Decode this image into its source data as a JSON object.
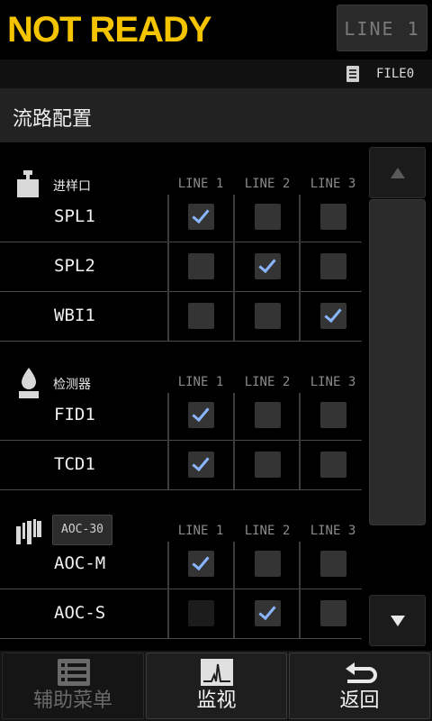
{
  "status": {
    "text": "NOT READY",
    "line": "LINE 1"
  },
  "file": {
    "label": "FILE0"
  },
  "screen_title": "流路配置",
  "columns": [
    "LINE 1",
    "LINE 2",
    "LINE 3"
  ],
  "groups": [
    {
      "label": "进样口",
      "icon": "injector-icon",
      "rows": [
        {
          "label": "SPL1",
          "checks": [
            true,
            false,
            false
          ]
        },
        {
          "label": "SPL2",
          "checks": [
            false,
            true,
            false
          ]
        },
        {
          "label": "WBI1",
          "checks": [
            false,
            false,
            true
          ]
        }
      ]
    },
    {
      "label": "检测器",
      "icon": "detector-icon",
      "rows": [
        {
          "label": "FID1",
          "checks": [
            true,
            false,
            false
          ]
        },
        {
          "label": "TCD1",
          "checks": [
            true,
            false,
            false
          ]
        }
      ]
    },
    {
      "label": "AOC-30",
      "icon": "autosampler-icon",
      "rows": [
        {
          "label": "AOC-M",
          "checks": [
            true,
            false,
            false
          ]
        },
        {
          "label": "AOC-S",
          "checks": [
            false,
            true,
            false
          ]
        }
      ]
    }
  ],
  "nav": {
    "aux": "辅助菜单",
    "monitor": "监视",
    "back": "返回"
  },
  "colors": {
    "status": "#f5c400",
    "check": "#8ab6ff",
    "background": "#000000"
  }
}
